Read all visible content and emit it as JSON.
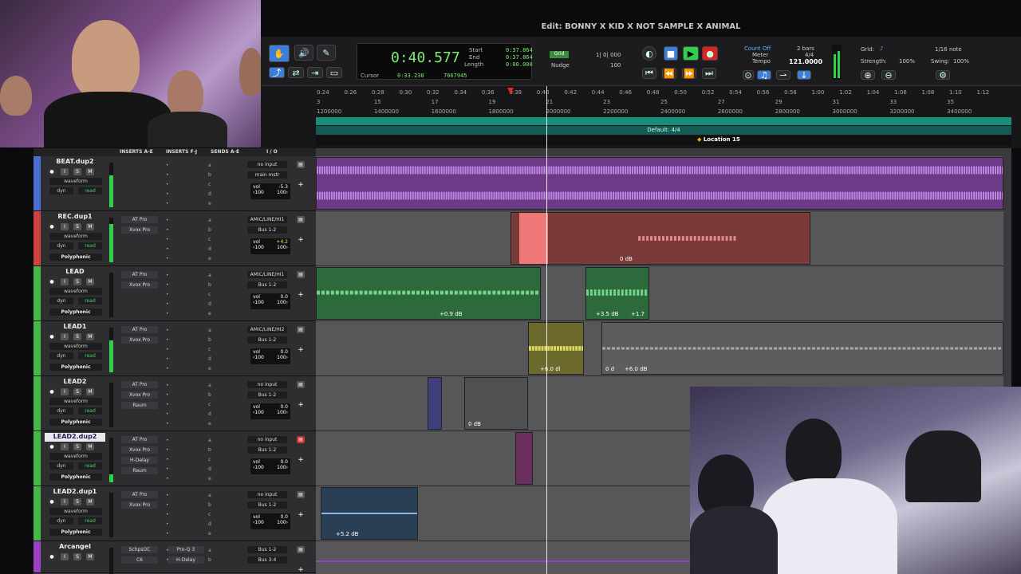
{
  "window": {
    "title": "Edit: BONNY X KID X NOT SAMPLE X ANIMAL"
  },
  "counter": {
    "main": "0:40.577",
    "start_label": "Start",
    "end_label": "End",
    "length_label": "Length",
    "start": "0:37.864",
    "end": "0:37.864",
    "length": "0:00.000",
    "cursor_label": "Cursor",
    "cursor": "0:33.238",
    "samples": "7667945"
  },
  "grid_nudge": {
    "grid_label": "Grid",
    "grid_value": "1| 0| 000",
    "nudge_label": "Nudge",
    "nudge_value": "100"
  },
  "meter_tempo": {
    "count_off": "Count Off",
    "meter": "Meter",
    "tempo": "Tempo",
    "bars": "2 bars",
    "sig": "4/4",
    "tempo_value": "121.0000"
  },
  "grid_panel": {
    "grid": "Grid:",
    "note": "1/16 note",
    "strength": "Strength:",
    "strength_v": "100%",
    "swing": "Swing:",
    "swing_v": "100%"
  },
  "ruler": {
    "times": [
      "0:24",
      "0:26",
      "0:28",
      "0:30",
      "0:32",
      "0:34",
      "0:36",
      "0:38",
      "0:40",
      "0:42",
      "0:44",
      "0:46",
      "0:48",
      "0:50",
      "0:52",
      "0:54",
      "0:56",
      "0:58",
      "1:00",
      "1:02",
      "1:04",
      "1:06",
      "1:08",
      "1:10",
      "1:12"
    ],
    "bars": [
      "3",
      "15",
      "17",
      "19",
      "21",
      "23",
      "25",
      "27",
      "29",
      "31",
      "33",
      "35"
    ],
    "samples": [
      "1200000",
      "1400000",
      "1600000",
      "1800000",
      "2000000",
      "2200000",
      "2400000",
      "2600000",
      "2800000",
      "3000000",
      "3200000",
      "3400000"
    ],
    "signature": "Default: 4/4",
    "location": "Location 15"
  },
  "columns": {
    "inserts_ae": "INSERTS A-E",
    "inserts_fj": "INSERTS F-J",
    "sends_ae": "SENDS A-E",
    "io": "I / O"
  },
  "colors": {
    "purple": "#8e3fb0",
    "red": "#b94040",
    "green": "#4bbd47",
    "accent": "#3b7fd9"
  },
  "tracks": [
    {
      "name": "BEAT.dup2",
      "ins1": "",
      "ins2": "",
      "ins3": "",
      "input": "no input",
      "output": "main mstr",
      "vol": "-5.3",
      "pan": "100",
      "mode": "",
      "color": "#4b6fd1"
    },
    {
      "name": "REC.dup1",
      "ins1": "AT Pro",
      "ins2": "Xvox Pro",
      "ins3": "",
      "input": "AMIC/LINE/HI1",
      "output": "Bus 1-2",
      "vol": "+4.2",
      "pan": "100",
      "mode": "Polyphonic",
      "color": "#d04242"
    },
    {
      "name": "LEAD",
      "ins1": "AT Pro",
      "ins2": "Xvox Pro",
      "ins3": "",
      "input": "AMIC/LINE/HI1",
      "output": "Bus 1-2",
      "vol": "0.0",
      "pan": "100",
      "mode": "Polyphonic",
      "color": "#45b847"
    },
    {
      "name": "LEAD1",
      "ins1": "AT Pro",
      "ins2": "Xvox Pro",
      "ins3": "",
      "input": "AMIC/LINE/HI2",
      "output": "Bus 1-2",
      "vol": "0.0",
      "pan": "100",
      "mode": "Polyphonic",
      "color": "#45b847"
    },
    {
      "name": "LEAD2",
      "ins1": "AT Pro",
      "ins2": "Xvox Pro",
      "ins3": "Raum",
      "input": "no input",
      "output": "Bus 1-2",
      "vol": "0.0",
      "pan": "100",
      "mode": "Polyphonic",
      "color": "#45b847"
    },
    {
      "name": "LEAD2.dup2",
      "ins1": "AT Pro",
      "ins2": "Xvox Pro",
      "ins3": "H-Delay",
      "ins4": "Raum",
      "input": "no input",
      "output": "Bus 1-2",
      "vol": "0.0",
      "pan": "100",
      "mode": "Polyphonic",
      "color": "#45b847"
    },
    {
      "name": "LEAD2.dup1",
      "ins1": "AT Pro",
      "ins2": "Xvox Pro",
      "ins3": "",
      "input": "no input",
      "output": "Bus 1-2",
      "vol": "0.0",
      "pan": "100",
      "mode": "Polyphonic",
      "color": "#45b847"
    },
    {
      "name": "Arcangel",
      "ins1": "SchpsOC",
      "ins2": "C6",
      "ins3": "",
      "input": "Bus 1-2",
      "output": "Bus 3-4",
      "vol": "",
      "pan": "",
      "mode": "",
      "insf1": "Pro-Q 3",
      "insf2": "H-Delay",
      "color": "#9b3fc4"
    }
  ],
  "track_labels": {
    "waveform": "waveform",
    "dyn": "dyn",
    "read": "read",
    "vol": "vol",
    "rec": "record"
  },
  "clip_labels": {
    "rec": "0 dB",
    "lead_a": "+0.9 dB",
    "lead_b": "+3.5 dB",
    "lead_c": "+1.7",
    "lead1_a": "+6.0 dl",
    "lead1_b": "0 d",
    "lead1_c": "+6.0 dB",
    "lead2": "0 dB",
    "dup1": "+5.2 dB"
  }
}
